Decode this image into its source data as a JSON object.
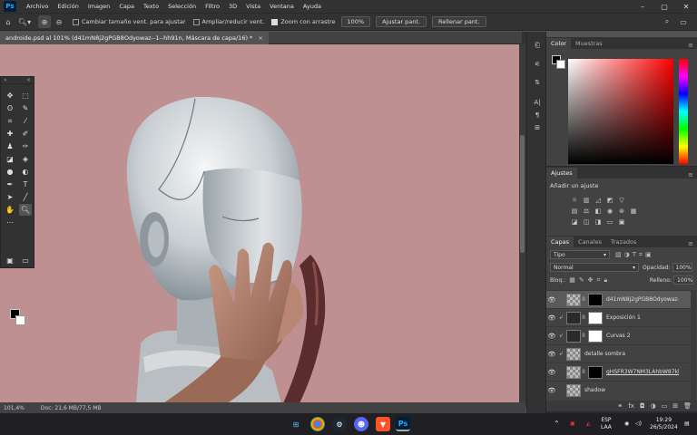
{
  "app": {
    "logo": "Ps"
  },
  "menu": [
    "Archivo",
    "Edición",
    "Imagen",
    "Capa",
    "Texto",
    "Selección",
    "Filtro",
    "3D",
    "Vista",
    "Ventana",
    "Ayuda"
  ],
  "options": {
    "resize_windows": "Cambiar tamaño vent. para ajustar",
    "zoom_all": "Ampliar/reducir vent.",
    "scrubby_zoom": "Zoom con arrastre",
    "zoom_value": "100%",
    "fit_screen": "Ajustar pant.",
    "fill_screen": "Rellenar pant."
  },
  "document": {
    "tab_title": "androide.psd al 101% (d41mN8j2gPGB8Odyowaz--1--hh91n, Máscara de capa/16) *",
    "tab_close": "×"
  },
  "status": {
    "zoom": "101,4%",
    "doc": "Doc: 21,6 MB/77,5 MB"
  },
  "color_panel": {
    "tabs": [
      "Color",
      "Muestras"
    ]
  },
  "adjust_panel": {
    "tabs": [
      "Ajustes"
    ],
    "title": "Añadir un ajuste"
  },
  "layers_panel": {
    "tabs": [
      "Capas",
      "Canales",
      "Trazados"
    ],
    "filter": "Tipo",
    "blend_mode": "Normal",
    "opacity_label": "Opacidad:",
    "opacity_value": "100%",
    "lock_label": "Bloq.:",
    "fill_label": "Relleno:",
    "fill_value": "100%",
    "layers": [
      {
        "name": "d41mN8j2gPGB8Odyowaz--1-...",
        "active": true
      },
      {
        "name": "Exposición 1",
        "active": false
      },
      {
        "name": "Curvas 2",
        "active": false
      },
      {
        "name": "detalle sombra",
        "active": false
      },
      {
        "name": "gHSFR3W7NM3LAhbW87kl--1-...",
        "active": false
      },
      {
        "name": "shadow",
        "active": false
      }
    ]
  },
  "taskbar": {
    "lang_top": "ESP",
    "lang_bottom": "LAA",
    "time": "19:29",
    "date": "26/5/2024"
  },
  "colors": {
    "canvas_bg": "#bf9091",
    "ps_accent": "#31a8ff"
  },
  "icons": [
    "home-icon",
    "zoom-icon",
    "search-icon",
    "workspace-icon",
    "share-icon",
    "eye-icon",
    "link-icon",
    "fx-icon",
    "trash-icon",
    "windows-icon",
    "chrome-icon",
    "steam-icon",
    "discord-icon",
    "brave-icon",
    "photoshop-icon"
  ]
}
